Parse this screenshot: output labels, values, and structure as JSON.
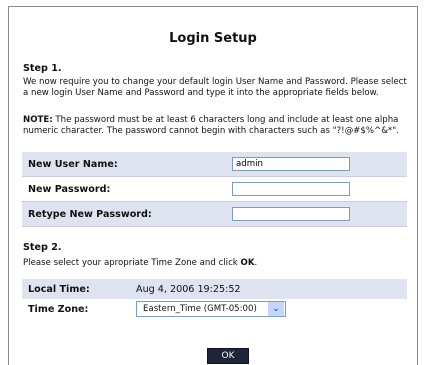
{
  "page": {
    "title": "Login Setup"
  },
  "step1": {
    "heading": "Step 1.",
    "intro": "We now require you to change your default login User Name and Password. Please select a new login User Name and Password and type it into the appropriate fields below.",
    "note_label": "NOTE:",
    "note_text": "The password must be at least 6 characters long and include at least one alpha numeric character. The password cannot begin with characters such as \"?!@#$%^&*\"."
  },
  "form": {
    "username": {
      "label": "New User Name:",
      "value": "admin"
    },
    "password": {
      "label": "New Password:",
      "value": ""
    },
    "retype": {
      "label": "Retype New Password:",
      "value": ""
    }
  },
  "step2": {
    "heading": "Step 2.",
    "text_before": "Please select your apropriate Time Zone and click",
    "text_bold": "OK",
    "text_after": "."
  },
  "time": {
    "local_label": "Local Time:",
    "local_value": "Aug 4, 2006 19:25:52",
    "zone_label": "Time Zone:",
    "zone_value": "Eastern_Time (GMT-05:00)"
  },
  "actions": {
    "ok_label": "OK"
  },
  "icons": {
    "dropdown": "chevron-down-icon"
  },
  "colors": {
    "shade_row": "#dfe3ef",
    "ok_button": "#20243b"
  }
}
